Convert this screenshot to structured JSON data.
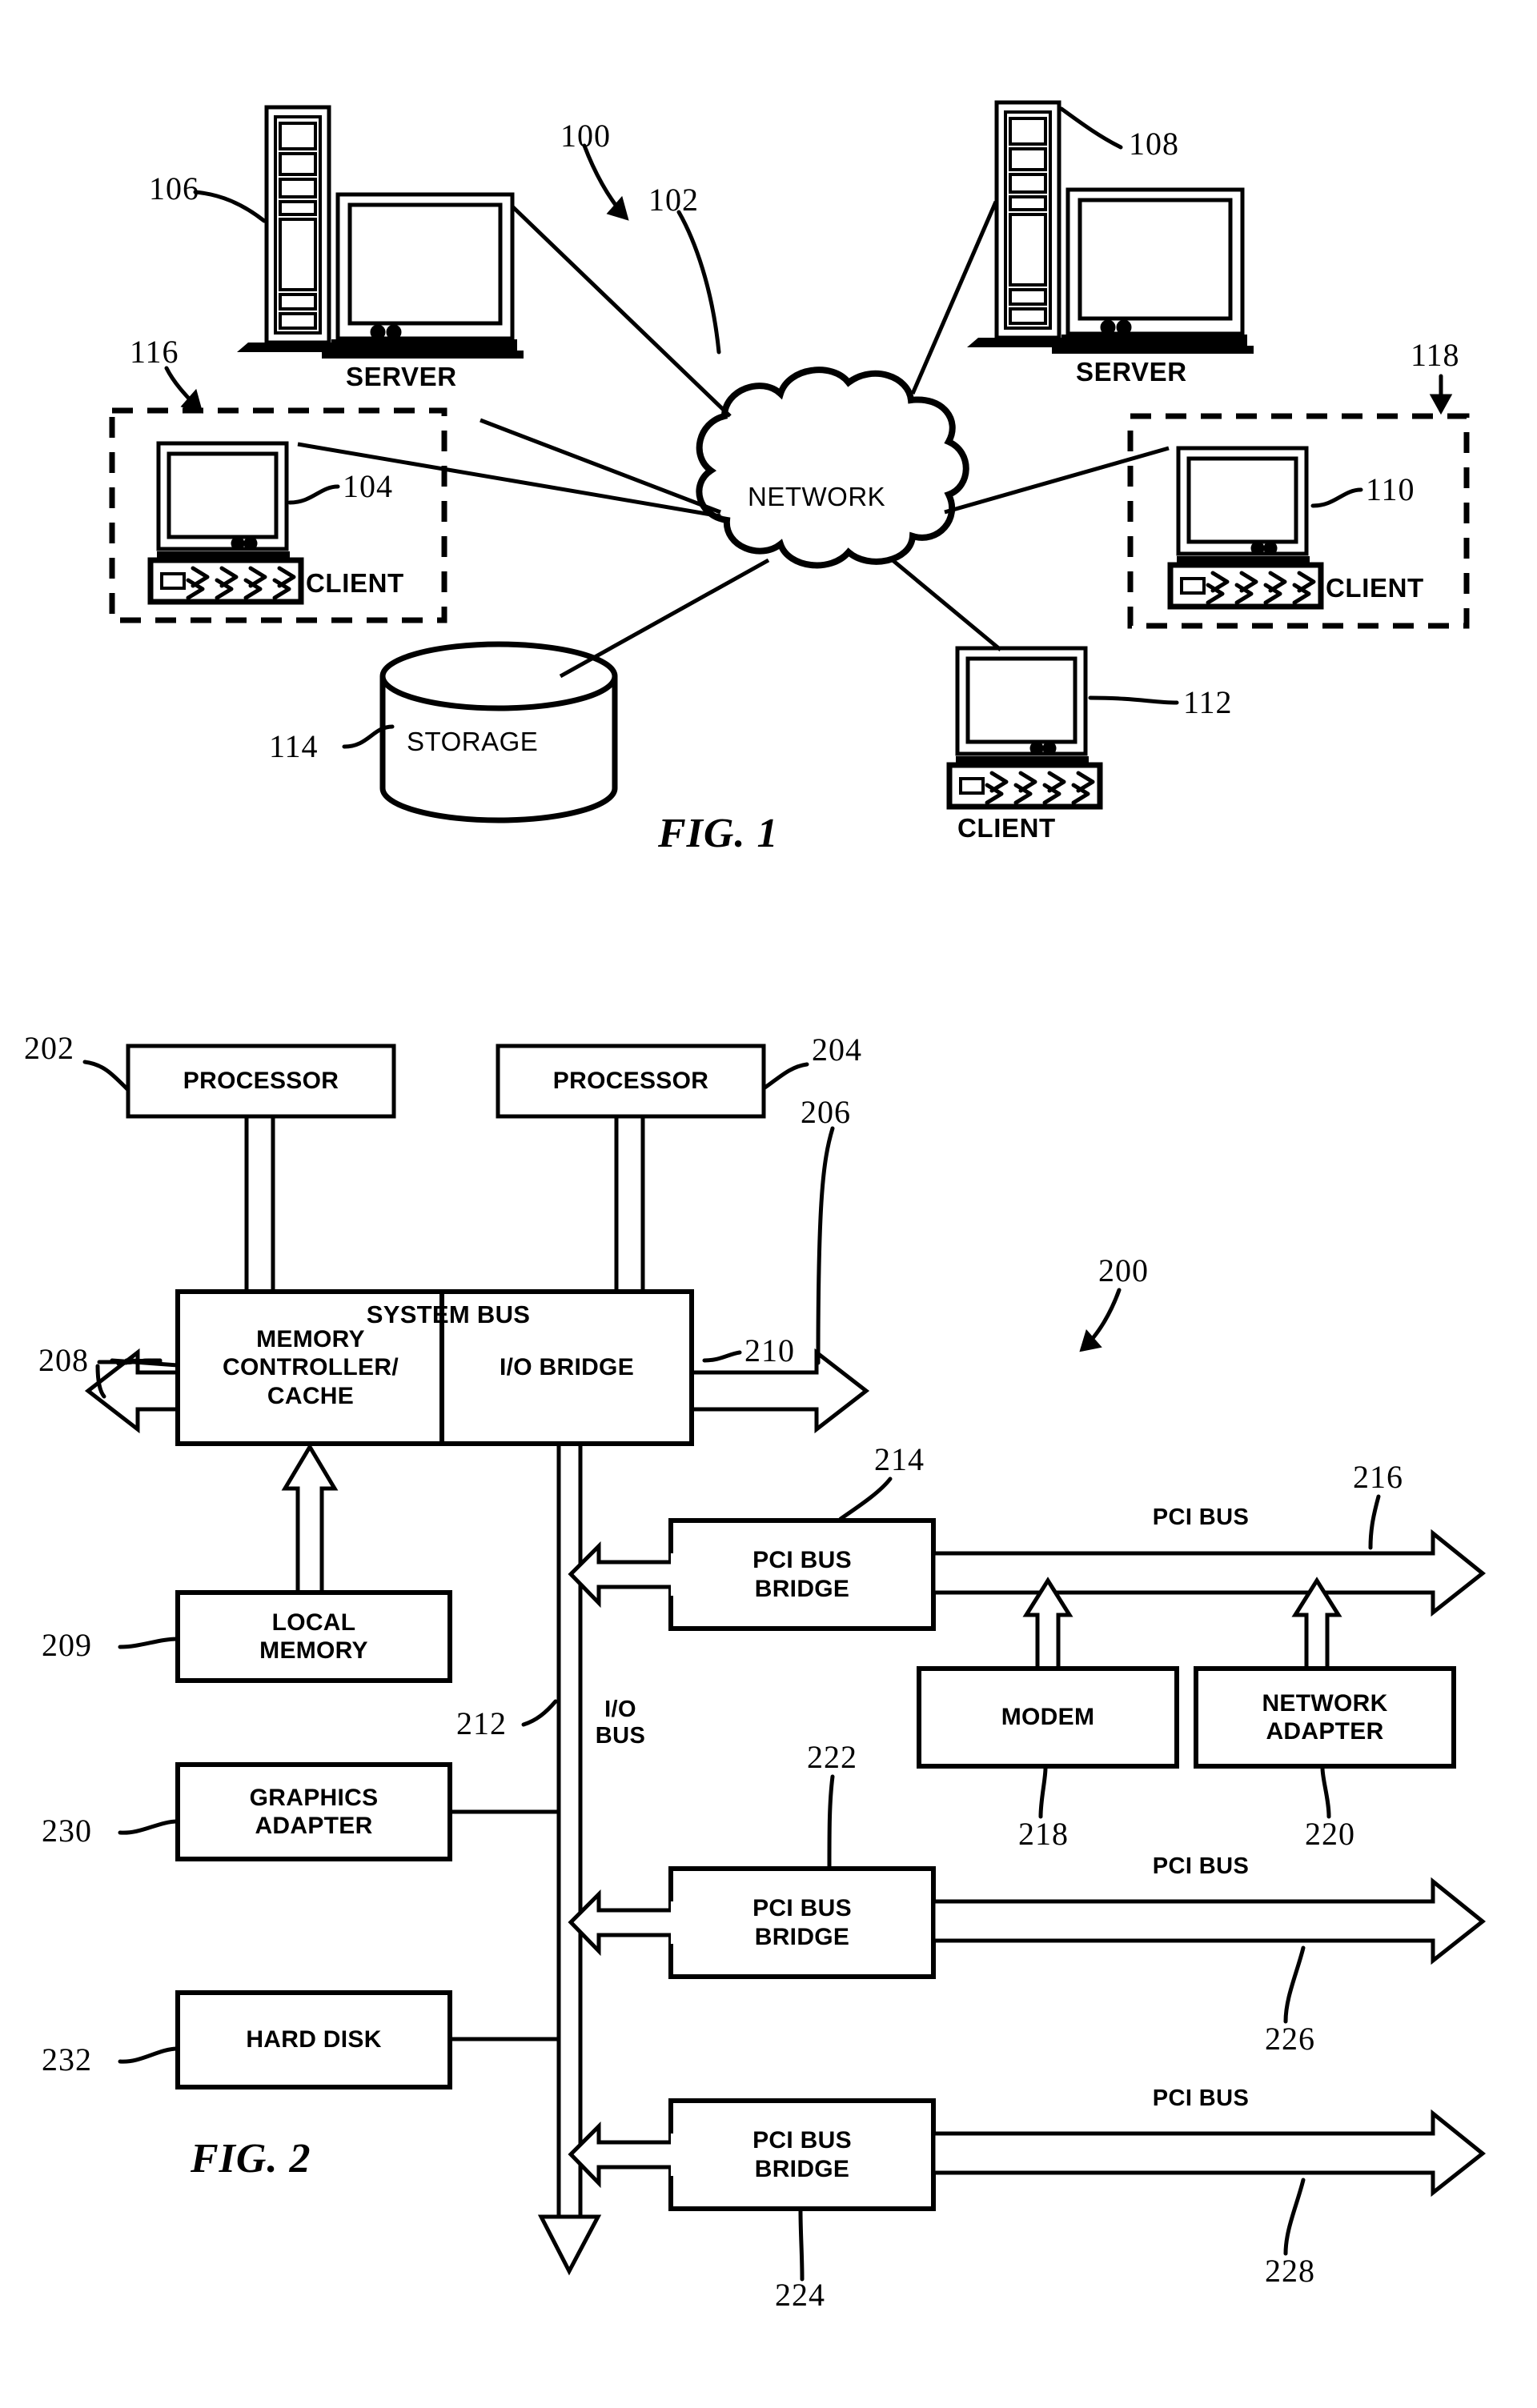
{
  "figures": [
    {
      "caption": "FIG. 1",
      "title_ref": "100",
      "nodes": [
        {
          "id": "106",
          "label": "SERVER",
          "kind": "server"
        },
        {
          "id": "108",
          "label": "SERVER",
          "kind": "server"
        },
        {
          "id": "102",
          "label": "NETWORK",
          "kind": "cloud"
        },
        {
          "id": "104",
          "label": "CLIENT",
          "kind": "client"
        },
        {
          "id": "110",
          "label": "CLIENT",
          "kind": "client"
        },
        {
          "id": "112",
          "label": "CLIENT",
          "kind": "client"
        },
        {
          "id": "114",
          "label": "STORAGE",
          "kind": "cylinder"
        },
        {
          "id": "116",
          "label": "",
          "kind": "dashed-group"
        },
        {
          "id": "118",
          "label": "",
          "kind": "dashed-group"
        }
      ]
    },
    {
      "caption": "FIG. 2",
      "title_ref": "200",
      "nodes": [
        {
          "id": "202",
          "label": "PROCESSOR",
          "kind": "box"
        },
        {
          "id": "204",
          "label": "PROCESSOR",
          "kind": "box"
        },
        {
          "id": "206",
          "label": "SYSTEM BUS",
          "kind": "bus"
        },
        {
          "id": "208",
          "label": "MEMORY\nCONTROLLER/\nCACHE",
          "kind": "box"
        },
        {
          "id": "210",
          "label": "I/O BRIDGE",
          "kind": "box"
        },
        {
          "id": "209",
          "label": "LOCAL\nMEMORY",
          "kind": "box"
        },
        {
          "id": "212",
          "label": "I/O\nBUS",
          "kind": "bus-vertical"
        },
        {
          "id": "214",
          "label": "PCI BUS\nBRIDGE",
          "kind": "box"
        },
        {
          "id": "216",
          "label": "PCI BUS",
          "kind": "bus"
        },
        {
          "id": "218",
          "label": "MODEM",
          "kind": "box"
        },
        {
          "id": "220",
          "label": "NETWORK\nADAPTER",
          "kind": "box"
        },
        {
          "id": "222",
          "label": "PCI BUS\nBRIDGE",
          "kind": "box"
        },
        {
          "id": "226",
          "label": "PCI BUS",
          "kind": "bus"
        },
        {
          "id": "224",
          "label": "PCI BUS\nBRIDGE",
          "kind": "box"
        },
        {
          "id": "228",
          "label": "PCI BUS",
          "kind": "bus"
        },
        {
          "id": "230",
          "label": "GRAPHICS\nADAPTER",
          "kind": "box"
        },
        {
          "id": "232",
          "label": "HARD DISK",
          "kind": "box"
        }
      ]
    }
  ],
  "fig1": {
    "caption": "FIG. 1",
    "system_ref": "100",
    "network": {
      "label": "NETWORK",
      "ref": "102"
    },
    "server_left": {
      "label": "SERVER",
      "ref": "106"
    },
    "server_right": {
      "label": "SERVER",
      "ref": "108"
    },
    "client_left": {
      "label": "CLIENT",
      "ref": "104",
      "group_ref": "116"
    },
    "client_right": {
      "label": "CLIENT",
      "ref": "110",
      "group_ref": "118"
    },
    "client_bottom": {
      "label": "CLIENT",
      "ref": "112"
    },
    "storage": {
      "label": "STORAGE",
      "ref": "114"
    }
  },
  "fig2": {
    "caption": "FIG. 2",
    "system_ref": "200",
    "processor_1": {
      "label": "PROCESSOR",
      "ref": "202"
    },
    "processor_2": {
      "label": "PROCESSOR",
      "ref": "204"
    },
    "system_bus": {
      "label": "SYSTEM BUS",
      "ref": "206"
    },
    "memory_controller": {
      "label": "MEMORY\nCONTROLLER/\nCACHE",
      "ref": "208"
    },
    "io_bridge": {
      "label": "I/O BRIDGE",
      "ref": "210"
    },
    "local_memory": {
      "label": "LOCAL\nMEMORY",
      "ref": "209"
    },
    "io_bus": {
      "label": "I/O\nBUS",
      "ref": "212"
    },
    "pci_bridge_1": {
      "label": "PCI BUS\nBRIDGE",
      "ref": "214"
    },
    "pci_bus_1": {
      "label": "PCI BUS",
      "ref": "216"
    },
    "modem": {
      "label": "MODEM",
      "ref": "218"
    },
    "network_adapter": {
      "label": "NETWORK\nADAPTER",
      "ref": "220"
    },
    "pci_bridge_2": {
      "label": "PCI BUS\nBRIDGE",
      "ref": "222"
    },
    "pci_bus_2": {
      "label": "PCI BUS",
      "ref": "226"
    },
    "pci_bridge_3": {
      "label": "PCI BUS\nBRIDGE",
      "ref": "224"
    },
    "pci_bus_3": {
      "label": "PCI BUS",
      "ref": "228"
    },
    "graphics_adapter": {
      "label": "GRAPHICS\nADAPTER",
      "ref": "230"
    },
    "hard_disk": {
      "label": "HARD DISK",
      "ref": "232"
    }
  }
}
